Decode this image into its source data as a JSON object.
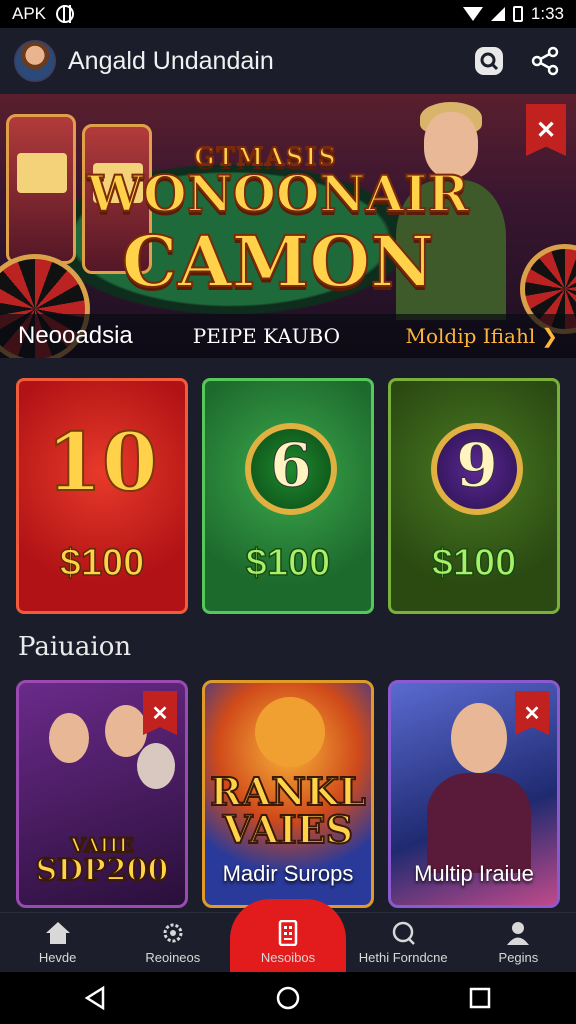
{
  "status_bar": {
    "left_label": "APK",
    "time": "1:33"
  },
  "app_bar": {
    "title": "Angald Undandain"
  },
  "hero": {
    "title_line1": "GTMASIS",
    "title_line2": "WONOONAIR",
    "title_line3": "CAMON",
    "strip_left": "Neooadsia",
    "strip_middle": "PEIPE KAUBO",
    "strip_right": "Moldip Ifiahl"
  },
  "tiles": [
    {
      "number": "10",
      "price": "$100",
      "color": "red"
    },
    {
      "number": "6",
      "price": "$100",
      "color": "green"
    },
    {
      "number": "9",
      "price": "$100",
      "color": "olive"
    }
  ],
  "section": {
    "title": "Paiuaion"
  },
  "games": [
    {
      "line1": "VAIIE",
      "line2": "SDP200",
      "label": ""
    },
    {
      "line1": "RANKL",
      "line2": "VAIES",
      "label": "Madir Surops"
    },
    {
      "line1": "",
      "line2": "",
      "label": "Multip Iraiue"
    }
  ],
  "bottom_nav": [
    {
      "label": "Hevde",
      "icon": "home-icon"
    },
    {
      "label": "Reoineos",
      "icon": "gear-icon"
    },
    {
      "label": "Nesoibos",
      "icon": "slot-machine-icon",
      "active": true
    },
    {
      "label": "Hethi Forndcne",
      "icon": "search-icon"
    },
    {
      "label": "Pegins",
      "icon": "profile-icon"
    }
  ],
  "colors": {
    "accent": "#e21c1c",
    "gold": "#ffd24a",
    "background": "#1b1e2a"
  }
}
